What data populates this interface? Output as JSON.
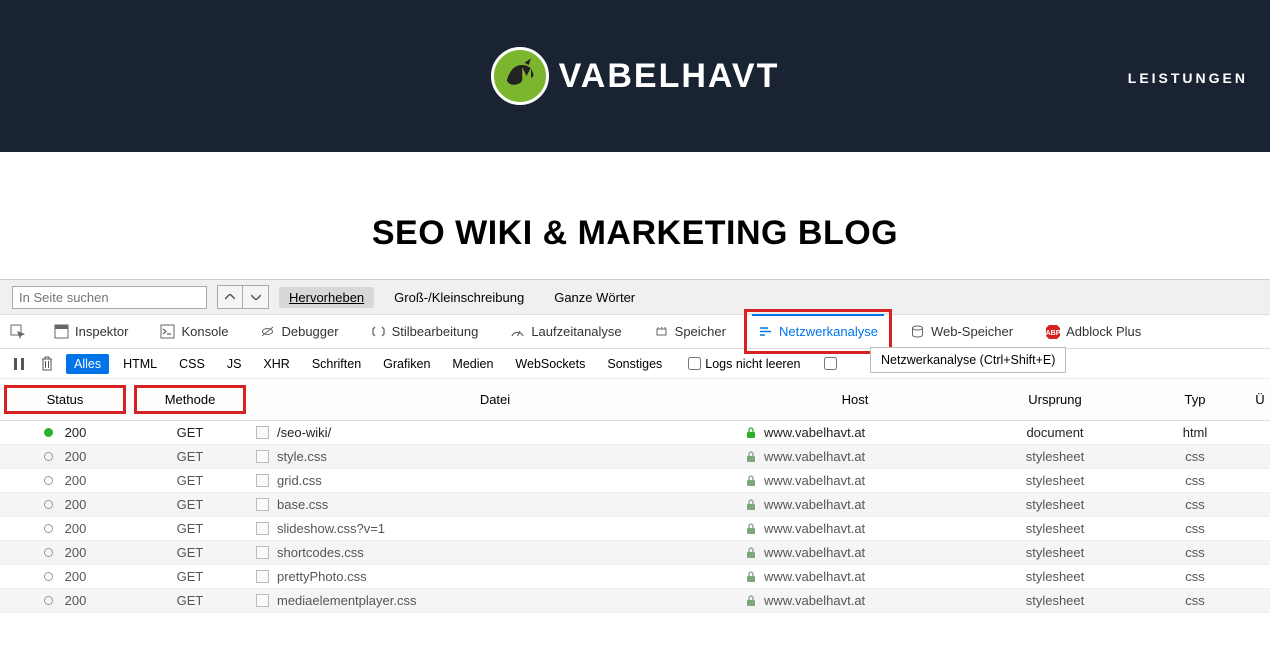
{
  "header": {
    "brand": "VABELHAVT",
    "nav": "LEISTUNGEN"
  },
  "page": {
    "title": "SEO WIKI & MARKETING BLOG"
  },
  "findbar": {
    "placeholder": "In Seite suchen",
    "highlight": "Hervorheben",
    "case": "Groß-/Kleinschreibung",
    "wholewords": "Ganze Wörter"
  },
  "devtools": {
    "tabs": {
      "inspector": "Inspektor",
      "console": "Konsole",
      "debugger": "Debugger",
      "styleeditor": "Stilbearbeitung",
      "performance": "Laufzeitanalyse",
      "memory": "Speicher",
      "network": "Netzwerkanalyse",
      "storage": "Web-Speicher",
      "adblock": "Adblock Plus"
    },
    "tooltip": "Netzwerkanalyse (Ctrl+Shift+E)"
  },
  "filters": {
    "all": "Alles",
    "items": [
      "HTML",
      "CSS",
      "JS",
      "XHR",
      "Schriften",
      "Grafiken",
      "Medien",
      "WebSockets",
      "Sonstiges"
    ],
    "persist": "Logs nicht leeren"
  },
  "table": {
    "headers": {
      "status": "Status",
      "method": "Methode",
      "file": "Datei",
      "host": "Host",
      "origin": "Ursprung",
      "type": "Typ",
      "last": "Ü"
    },
    "rows": [
      {
        "status_dot": "green",
        "status": "200",
        "method": "GET",
        "file": "/seo-wiki/",
        "host": "www.vabelhavt.at",
        "origin": "document",
        "type": "html"
      },
      {
        "status_dot": "grey",
        "status": "200",
        "method": "GET",
        "file": "style.css",
        "host": "www.vabelhavt.at",
        "origin": "stylesheet",
        "type": "css"
      },
      {
        "status_dot": "grey",
        "status": "200",
        "method": "GET",
        "file": "grid.css",
        "host": "www.vabelhavt.at",
        "origin": "stylesheet",
        "type": "css"
      },
      {
        "status_dot": "grey",
        "status": "200",
        "method": "GET",
        "file": "base.css",
        "host": "www.vabelhavt.at",
        "origin": "stylesheet",
        "type": "css"
      },
      {
        "status_dot": "grey",
        "status": "200",
        "method": "GET",
        "file": "slideshow.css?v=1",
        "host": "www.vabelhavt.at",
        "origin": "stylesheet",
        "type": "css"
      },
      {
        "status_dot": "grey",
        "status": "200",
        "method": "GET",
        "file": "shortcodes.css",
        "host": "www.vabelhavt.at",
        "origin": "stylesheet",
        "type": "css"
      },
      {
        "status_dot": "grey",
        "status": "200",
        "method": "GET",
        "file": "prettyPhoto.css",
        "host": "www.vabelhavt.at",
        "origin": "stylesheet",
        "type": "css"
      },
      {
        "status_dot": "grey",
        "status": "200",
        "method": "GET",
        "file": "mediaelementplayer.css",
        "host": "www.vabelhavt.at",
        "origin": "stylesheet",
        "type": "css"
      }
    ]
  }
}
